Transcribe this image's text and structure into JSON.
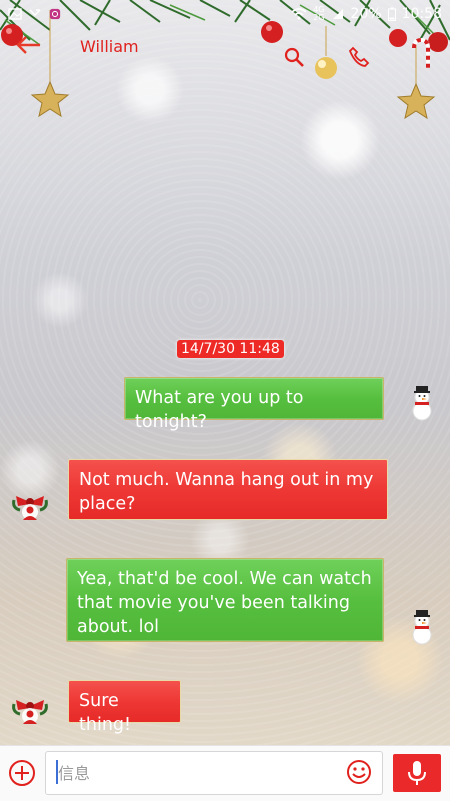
{
  "status_bar": {
    "network_top": "4G",
    "network_bottom": "2G",
    "battery_percent": "20%",
    "time": "10:58"
  },
  "header": {
    "contact_name": "William"
  },
  "conversation": {
    "timestamp": "14/7/30 11:48",
    "messages": [
      {
        "direction": "outgoing",
        "text": "What are you up to tonight?"
      },
      {
        "direction": "incoming",
        "text": "Not much. Wanna hang out in my place?"
      },
      {
        "direction": "outgoing",
        "text": "Yea, that'd be cool. We can watch that movie you've been talking about. lol"
      },
      {
        "direction": "incoming",
        "text": "Sure thing!"
      }
    ]
  },
  "composer": {
    "placeholder": "信息"
  },
  "colors": {
    "accent_red": "#e0211d",
    "bubble_green": "#57bf3f",
    "bubble_red": "#ee3835"
  }
}
